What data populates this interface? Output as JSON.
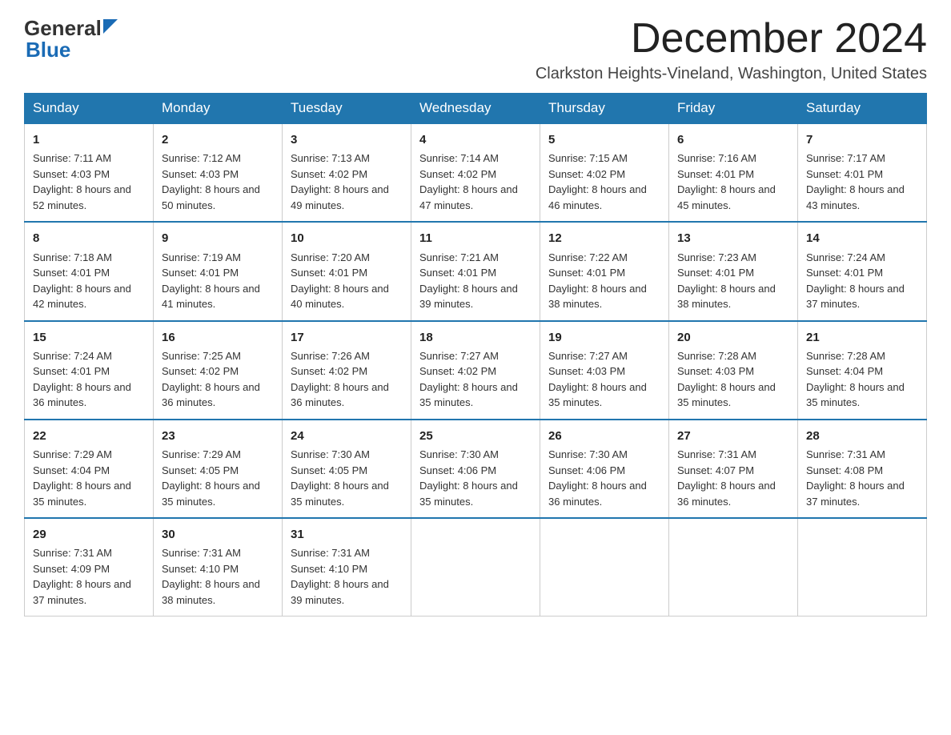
{
  "logo": {
    "general": "General",
    "blue": "Blue"
  },
  "title": {
    "month": "December 2024",
    "location": "Clarkston Heights-Vineland, Washington, United States"
  },
  "weekdays": [
    "Sunday",
    "Monday",
    "Tuesday",
    "Wednesday",
    "Thursday",
    "Friday",
    "Saturday"
  ],
  "weeks": [
    [
      {
        "day": "1",
        "sunrise": "Sunrise: 7:11 AM",
        "sunset": "Sunset: 4:03 PM",
        "daylight": "Daylight: 8 hours and 52 minutes."
      },
      {
        "day": "2",
        "sunrise": "Sunrise: 7:12 AM",
        "sunset": "Sunset: 4:03 PM",
        "daylight": "Daylight: 8 hours and 50 minutes."
      },
      {
        "day": "3",
        "sunrise": "Sunrise: 7:13 AM",
        "sunset": "Sunset: 4:02 PM",
        "daylight": "Daylight: 8 hours and 49 minutes."
      },
      {
        "day": "4",
        "sunrise": "Sunrise: 7:14 AM",
        "sunset": "Sunset: 4:02 PM",
        "daylight": "Daylight: 8 hours and 47 minutes."
      },
      {
        "day": "5",
        "sunrise": "Sunrise: 7:15 AM",
        "sunset": "Sunset: 4:02 PM",
        "daylight": "Daylight: 8 hours and 46 minutes."
      },
      {
        "day": "6",
        "sunrise": "Sunrise: 7:16 AM",
        "sunset": "Sunset: 4:01 PM",
        "daylight": "Daylight: 8 hours and 45 minutes."
      },
      {
        "day": "7",
        "sunrise": "Sunrise: 7:17 AM",
        "sunset": "Sunset: 4:01 PM",
        "daylight": "Daylight: 8 hours and 43 minutes."
      }
    ],
    [
      {
        "day": "8",
        "sunrise": "Sunrise: 7:18 AM",
        "sunset": "Sunset: 4:01 PM",
        "daylight": "Daylight: 8 hours and 42 minutes."
      },
      {
        "day": "9",
        "sunrise": "Sunrise: 7:19 AM",
        "sunset": "Sunset: 4:01 PM",
        "daylight": "Daylight: 8 hours and 41 minutes."
      },
      {
        "day": "10",
        "sunrise": "Sunrise: 7:20 AM",
        "sunset": "Sunset: 4:01 PM",
        "daylight": "Daylight: 8 hours and 40 minutes."
      },
      {
        "day": "11",
        "sunrise": "Sunrise: 7:21 AM",
        "sunset": "Sunset: 4:01 PM",
        "daylight": "Daylight: 8 hours and 39 minutes."
      },
      {
        "day": "12",
        "sunrise": "Sunrise: 7:22 AM",
        "sunset": "Sunset: 4:01 PM",
        "daylight": "Daylight: 8 hours and 38 minutes."
      },
      {
        "day": "13",
        "sunrise": "Sunrise: 7:23 AM",
        "sunset": "Sunset: 4:01 PM",
        "daylight": "Daylight: 8 hours and 38 minutes."
      },
      {
        "day": "14",
        "sunrise": "Sunrise: 7:24 AM",
        "sunset": "Sunset: 4:01 PM",
        "daylight": "Daylight: 8 hours and 37 minutes."
      }
    ],
    [
      {
        "day": "15",
        "sunrise": "Sunrise: 7:24 AM",
        "sunset": "Sunset: 4:01 PM",
        "daylight": "Daylight: 8 hours and 36 minutes."
      },
      {
        "day": "16",
        "sunrise": "Sunrise: 7:25 AM",
        "sunset": "Sunset: 4:02 PM",
        "daylight": "Daylight: 8 hours and 36 minutes."
      },
      {
        "day": "17",
        "sunrise": "Sunrise: 7:26 AM",
        "sunset": "Sunset: 4:02 PM",
        "daylight": "Daylight: 8 hours and 36 minutes."
      },
      {
        "day": "18",
        "sunrise": "Sunrise: 7:27 AM",
        "sunset": "Sunset: 4:02 PM",
        "daylight": "Daylight: 8 hours and 35 minutes."
      },
      {
        "day": "19",
        "sunrise": "Sunrise: 7:27 AM",
        "sunset": "Sunset: 4:03 PM",
        "daylight": "Daylight: 8 hours and 35 minutes."
      },
      {
        "day": "20",
        "sunrise": "Sunrise: 7:28 AM",
        "sunset": "Sunset: 4:03 PM",
        "daylight": "Daylight: 8 hours and 35 minutes."
      },
      {
        "day": "21",
        "sunrise": "Sunrise: 7:28 AM",
        "sunset": "Sunset: 4:04 PM",
        "daylight": "Daylight: 8 hours and 35 minutes."
      }
    ],
    [
      {
        "day": "22",
        "sunrise": "Sunrise: 7:29 AM",
        "sunset": "Sunset: 4:04 PM",
        "daylight": "Daylight: 8 hours and 35 minutes."
      },
      {
        "day": "23",
        "sunrise": "Sunrise: 7:29 AM",
        "sunset": "Sunset: 4:05 PM",
        "daylight": "Daylight: 8 hours and 35 minutes."
      },
      {
        "day": "24",
        "sunrise": "Sunrise: 7:30 AM",
        "sunset": "Sunset: 4:05 PM",
        "daylight": "Daylight: 8 hours and 35 minutes."
      },
      {
        "day": "25",
        "sunrise": "Sunrise: 7:30 AM",
        "sunset": "Sunset: 4:06 PM",
        "daylight": "Daylight: 8 hours and 35 minutes."
      },
      {
        "day": "26",
        "sunrise": "Sunrise: 7:30 AM",
        "sunset": "Sunset: 4:06 PM",
        "daylight": "Daylight: 8 hours and 36 minutes."
      },
      {
        "day": "27",
        "sunrise": "Sunrise: 7:31 AM",
        "sunset": "Sunset: 4:07 PM",
        "daylight": "Daylight: 8 hours and 36 minutes."
      },
      {
        "day": "28",
        "sunrise": "Sunrise: 7:31 AM",
        "sunset": "Sunset: 4:08 PM",
        "daylight": "Daylight: 8 hours and 37 minutes."
      }
    ],
    [
      {
        "day": "29",
        "sunrise": "Sunrise: 7:31 AM",
        "sunset": "Sunset: 4:09 PM",
        "daylight": "Daylight: 8 hours and 37 minutes."
      },
      {
        "day": "30",
        "sunrise": "Sunrise: 7:31 AM",
        "sunset": "Sunset: 4:10 PM",
        "daylight": "Daylight: 8 hours and 38 minutes."
      },
      {
        "day": "31",
        "sunrise": "Sunrise: 7:31 AM",
        "sunset": "Sunset: 4:10 PM",
        "daylight": "Daylight: 8 hours and 39 minutes."
      },
      null,
      null,
      null,
      null
    ]
  ]
}
